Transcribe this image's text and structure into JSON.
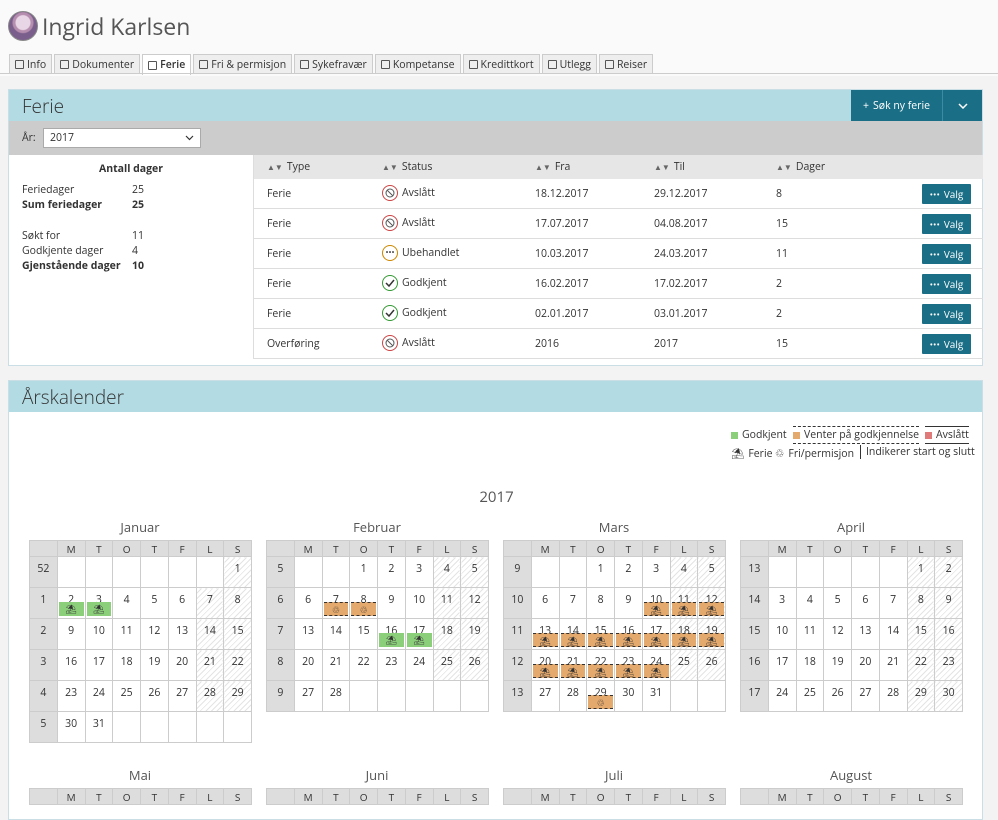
{
  "person": {
    "name": "Ingrid Karlsen"
  },
  "tabs": [
    {
      "label": "Info",
      "icon": "info-icon"
    },
    {
      "label": "Dokumenter",
      "icon": "document-icon"
    },
    {
      "label": "Ferie",
      "icon": "beach-umbrella-icon"
    },
    {
      "label": "Fri & permisjon",
      "icon": "leave-icon"
    },
    {
      "label": "Sykefravær",
      "icon": "heart-icon"
    },
    {
      "label": "Kompetanse",
      "icon": "lightbulb-icon"
    },
    {
      "label": "Kredittkort",
      "icon": "credit-card-icon"
    },
    {
      "label": "Utlegg",
      "icon": "receipt-icon"
    },
    {
      "label": "Reiser",
      "icon": "globe-icon"
    }
  ],
  "ferie": {
    "title": "Ferie",
    "new_button": "Søk ny ferie",
    "year_label": "År:",
    "year_value": "2017",
    "summary": {
      "title": "Antall dager",
      "rows": [
        {
          "label": "Feriedager",
          "value": "25"
        },
        {
          "label": "Sum feriedager",
          "value": "25"
        },
        {
          "label": "Søkt for",
          "value": "11"
        },
        {
          "label": "Godkjente dager",
          "value": "4"
        },
        {
          "label": "Gjenstående dager",
          "value": "10"
        }
      ]
    },
    "columns": [
      "Type",
      "Status",
      "Fra",
      "Til",
      "Dager"
    ],
    "rows": [
      {
        "type": "Ferie",
        "status": "Avslått",
        "icon": "rejected-icon",
        "fra": "18.12.2017",
        "til": "29.12.2017",
        "dager": "8"
      },
      {
        "type": "Ferie",
        "status": "Avslått",
        "icon": "rejected-icon",
        "fra": "17.07.2017",
        "til": "04.08.2017",
        "dager": "15"
      },
      {
        "type": "Ferie",
        "status": "Ubehandlet",
        "icon": "pending-icon",
        "fra": "10.03.2017",
        "til": "24.03.2017",
        "dager": "11"
      },
      {
        "type": "Ferie",
        "status": "Godkjent",
        "icon": "approved-icon",
        "fra": "16.02.2017",
        "til": "17.02.2017",
        "dager": "2"
      },
      {
        "type": "Ferie",
        "status": "Godkjent",
        "icon": "approved-icon",
        "fra": "02.01.2017",
        "til": "03.01.2017",
        "dager": "2"
      },
      {
        "type": "Overføring",
        "status": "Avslått",
        "icon": "rejected-icon",
        "fra": "2016",
        "til": "2017",
        "dager": "15"
      }
    ],
    "row_button": "Valg"
  },
  "calendar": {
    "title": "Årskalender",
    "year": "2017",
    "legend": {
      "approved": "Godkjent",
      "pending": "Venter på godkjennelse",
      "rejected": "Avslått",
      "vacation": "Ferie",
      "leave": "Fri/permisjon",
      "marker": "Indikerer start og slutt"
    },
    "colors": {
      "approved": "#8ccf7b",
      "pending": "#e4a96d",
      "rejected": "#e07a7a",
      "header": "#b3dbe3",
      "button": "#1a6e86"
    },
    "weekdays": [
      "M",
      "T",
      "O",
      "T",
      "F",
      "L",
      "S"
    ],
    "months": [
      {
        "name": "Januar",
        "weeks": [
          {
            "wk": "52",
            "days": [
              "",
              "",
              "",
              "",
              "",
              "",
              "1"
            ]
          },
          {
            "wk": "1",
            "days": [
              "2",
              "3",
              "4",
              "5",
              "6",
              "7",
              "8"
            ]
          },
          {
            "wk": "2",
            "days": [
              "9",
              "10",
              "11",
              "12",
              "13",
              "14",
              "15"
            ]
          },
          {
            "wk": "3",
            "days": [
              "16",
              "17",
              "18",
              "19",
              "20",
              "21",
              "22"
            ]
          },
          {
            "wk": "4",
            "days": [
              "23",
              "24",
              "25",
              "26",
              "27",
              "28",
              "29"
            ]
          },
          {
            "wk": "5",
            "days": [
              "30",
              "31",
              "",
              "",
              "",
              "",
              ""
            ]
          }
        ]
      },
      {
        "name": "Februar",
        "weeks": [
          {
            "wk": "5",
            "days": [
              "",
              "",
              "1",
              "2",
              "3",
              "4",
              "5"
            ]
          },
          {
            "wk": "6",
            "days": [
              "6",
              "7",
              "8",
              "9",
              "10",
              "11",
              "12"
            ]
          },
          {
            "wk": "7",
            "days": [
              "13",
              "14",
              "15",
              "16",
              "17",
              "18",
              "19"
            ]
          },
          {
            "wk": "8",
            "days": [
              "20",
              "21",
              "22",
              "23",
              "24",
              "25",
              "26"
            ]
          },
          {
            "wk": "9",
            "days": [
              "27",
              "28",
              "",
              "",
              "",
              "",
              ""
            ]
          }
        ]
      },
      {
        "name": "Mars",
        "weeks": [
          {
            "wk": "9",
            "days": [
              "",
              "",
              "1",
              "2",
              "3",
              "4",
              "5"
            ]
          },
          {
            "wk": "10",
            "days": [
              "6",
              "7",
              "8",
              "9",
              "10",
              "11",
              "12"
            ]
          },
          {
            "wk": "11",
            "days": [
              "13",
              "14",
              "15",
              "16",
              "17",
              "18",
              "19"
            ]
          },
          {
            "wk": "12",
            "days": [
              "20",
              "21",
              "22",
              "23",
              "24",
              "25",
              "26"
            ]
          },
          {
            "wk": "13",
            "days": [
              "27",
              "28",
              "29",
              "30",
              "31",
              "",
              ""
            ]
          }
        ]
      },
      {
        "name": "April",
        "weeks": [
          {
            "wk": "13",
            "days": [
              "",
              "",
              "",
              "",
              "",
              "1",
              "2"
            ]
          },
          {
            "wk": "14",
            "days": [
              "3",
              "4",
              "5",
              "6",
              "7",
              "8",
              "9"
            ]
          },
          {
            "wk": "15",
            "days": [
              "10",
              "11",
              "12",
              "13",
              "14",
              "15",
              "16"
            ]
          },
          {
            "wk": "16",
            "days": [
              "17",
              "18",
              "19",
              "20",
              "21",
              "22",
              "23"
            ]
          },
          {
            "wk": "17",
            "days": [
              "24",
              "25",
              "26",
              "27",
              "28",
              "29",
              "30"
            ]
          }
        ]
      },
      {
        "name": "Mai"
      },
      {
        "name": "Juni"
      },
      {
        "name": "Juli"
      },
      {
        "name": "August"
      }
    ]
  }
}
